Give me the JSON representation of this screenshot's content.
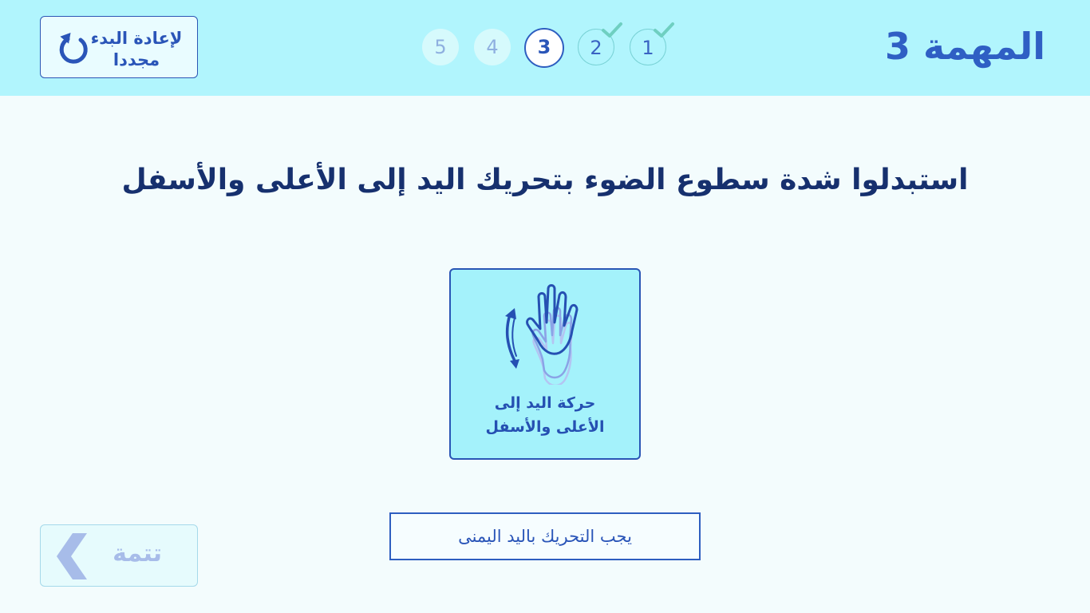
{
  "header": {
    "title": "المهمة 3",
    "restart_label": "لإعادة البدء مجددا",
    "restart_icon": "restart-icon",
    "steps": [
      {
        "label": "1",
        "state": "done"
      },
      {
        "label": "2",
        "state": "done"
      },
      {
        "label": "3",
        "state": "current"
      },
      {
        "label": "4",
        "state": "future"
      },
      {
        "label": "5",
        "state": "future"
      }
    ]
  },
  "main": {
    "instruction": "استبدلوا شدة سطوع الضوء بتحريك اليد إلى الأعلى والأسفل",
    "gesture_card": {
      "icon": "hand-up-down-icon",
      "label_line1": "حركة اليد إلى",
      "label_line2": "الأعلى والأسفل"
    },
    "hint": "يجب التحريك باليد اليمنى"
  },
  "footer": {
    "continue_label": "تتمة",
    "continue_icon": "chevron-left-icon"
  },
  "colors": {
    "header_bg": "#b1f5fd",
    "page_bg": "#f3fcfd",
    "accent": "#2e5ec0",
    "check": "#6fcfc1",
    "card_bg": "#a4f2fb"
  }
}
